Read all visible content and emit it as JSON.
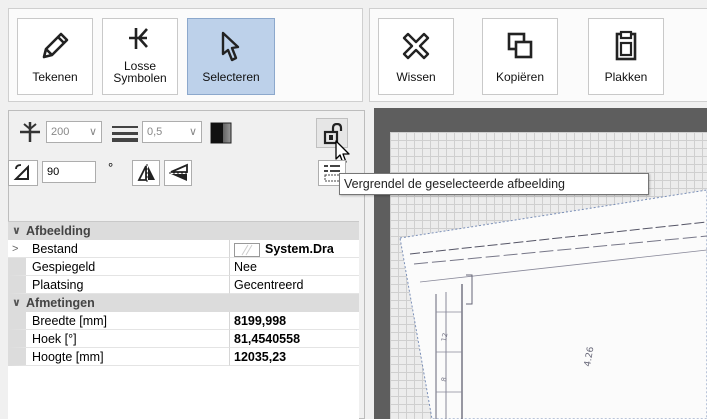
{
  "toolbar": {
    "buttons": [
      {
        "label": "Tekenen"
      },
      {
        "label_line1": "Losse",
        "label_line2": "Symbolen"
      },
      {
        "label": "Selecteren"
      },
      {
        "label": "Wissen"
      },
      {
        "label": "Kopiëren"
      },
      {
        "label": "Plakken"
      }
    ]
  },
  "controls": {
    "size_value": "200",
    "line_width_value": "0,5",
    "rotation_value": "90",
    "degree_symbol": "°"
  },
  "tooltip": {
    "text": "Vergrendel de geselecteerde afbeelding"
  },
  "properties": {
    "cat1": {
      "label": "Afbeelding",
      "expand": "∨"
    },
    "rows1": [
      {
        "name": "Bestand",
        "value": "System.Dra",
        "expand": ">",
        "bold": true
      },
      {
        "name": "Gespiegeld",
        "value": "Nee"
      },
      {
        "name": "Plaatsing",
        "value": "Gecentreerd"
      }
    ],
    "cat2": {
      "label": "Afmetingen",
      "expand": "∨"
    },
    "rows2": [
      {
        "name": "Breedte [mm]",
        "value": "8199,998"
      },
      {
        "name": "Hoek [°]",
        "value": "81,4540558"
      },
      {
        "name": "Hoogte [mm]",
        "value": "12035,23"
      }
    ]
  },
  "colors": {
    "accent_active": "#bdd1ea",
    "canvas_bg": "#5e5e5e"
  }
}
